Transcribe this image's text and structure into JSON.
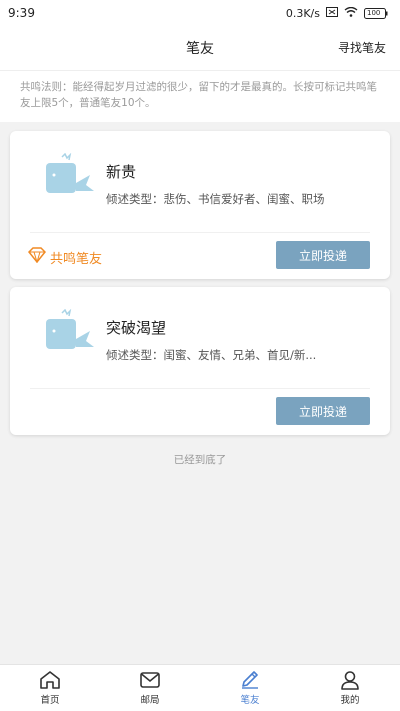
{
  "status_bar": {
    "time": "9:39",
    "network_speed": "0.3K/s",
    "battery": "100"
  },
  "header": {
    "title": "笔友",
    "right_link": "寻找笔友"
  },
  "notice": {
    "text": "共鸣法则：能经得起岁月过滤的很少，留下的才是最真的。长按可标记共鸣笔友上限5个，普通笔友10个。"
  },
  "cards": [
    {
      "name": "新贵",
      "types": "倾述类型：悲伤、书信爱好者、闺蜜、职场",
      "badge": "共鸣笔友",
      "button": "立即投递"
    },
    {
      "name": "突破渴望",
      "types": "倾述类型：闺蜜、友情、兄弟、首见/新...",
      "button": "立即投递"
    }
  ],
  "end_text": "已经到底了",
  "tabs": [
    {
      "label": "首页",
      "icon": "home-icon"
    },
    {
      "label": "邮局",
      "icon": "mail-icon"
    },
    {
      "label": "笔友",
      "icon": "pen-icon",
      "active": true
    },
    {
      "label": "我的",
      "icon": "user-icon"
    }
  ],
  "colors": {
    "accent": "#4a7fd0",
    "button": "#7aa3bf",
    "badge": "#f08a24",
    "whale": "#a9d3e6"
  }
}
